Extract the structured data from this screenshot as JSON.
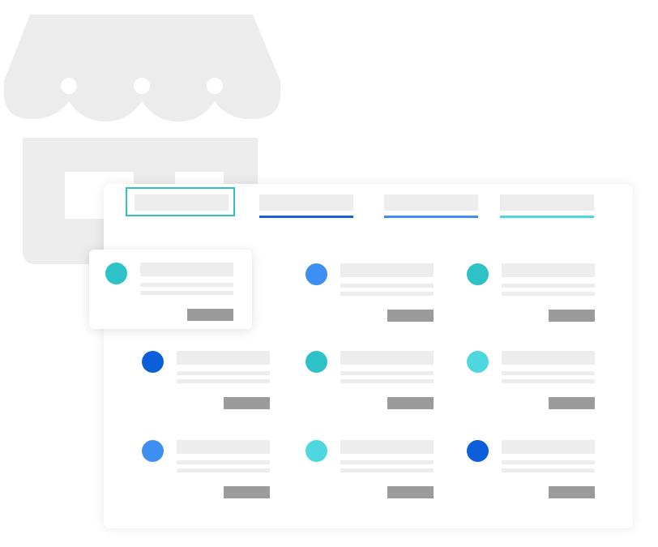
{
  "colors": {
    "storefront": "#ececec",
    "teal": "#2fc1c8",
    "light_cyan": "#4fd7de",
    "blue": "#3d8ff2",
    "dark_blue": "#0d5fd9",
    "placeholder": "#ededed",
    "button": "#9b9b9b"
  },
  "storefront": {
    "icon": "storefront-icon"
  },
  "tabs": [
    {
      "name": "tab-1",
      "selected": true
    },
    {
      "name": "tab-2",
      "underline": "#1565d4"
    },
    {
      "name": "tab-3",
      "underline": "#3d8ff2"
    },
    {
      "name": "tab-4",
      "underline": "#4fd7de"
    }
  ],
  "cards": [
    {
      "name": "card-1",
      "dot": "#2fc1c8",
      "raised": true
    },
    {
      "name": "card-2",
      "dot": "#3d8ff2"
    },
    {
      "name": "card-3",
      "dot": "#2fc1c8"
    },
    {
      "name": "card-4",
      "dot": "#0d5fd9"
    },
    {
      "name": "card-5",
      "dot": "#2fc1c8"
    },
    {
      "name": "card-6",
      "dot": "#4fd7de"
    },
    {
      "name": "card-7",
      "dot": "#3d8ff2"
    },
    {
      "name": "card-8",
      "dot": "#4fd7de"
    },
    {
      "name": "card-9",
      "dot": "#0d5fd9"
    }
  ]
}
